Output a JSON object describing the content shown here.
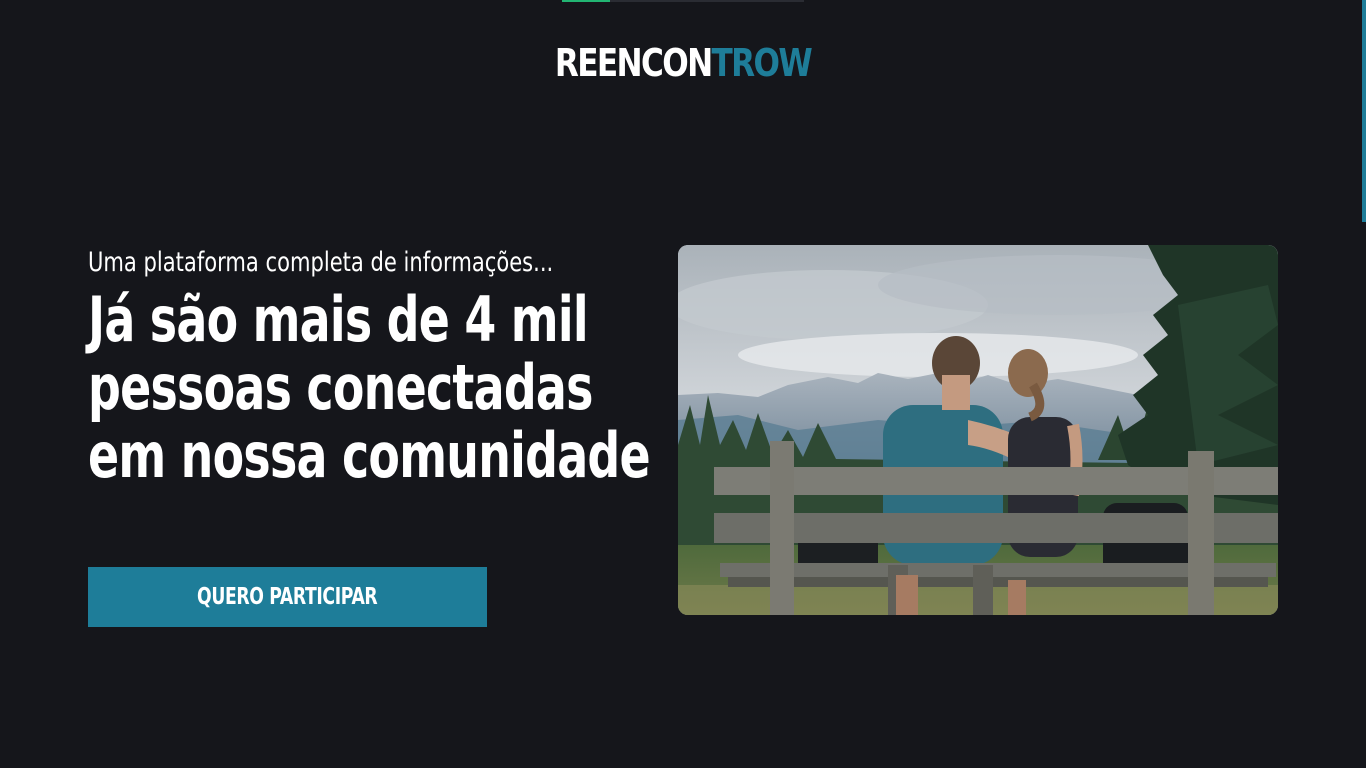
{
  "logo": {
    "part1": "REENCON",
    "part2": "TROW"
  },
  "hero": {
    "subtitle": "Uma plataforma completa de informações...",
    "headline_line1": "Já são mais de 4 mil",
    "headline_line2": "pessoas conectadas",
    "headline_line3": "em nossa comunidade",
    "cta_label": "QUERO PARTICIPAR",
    "image_alt": "Casal sentado em um banco de madeira olhando para as montanhas"
  },
  "colors": {
    "background": "#15161b",
    "accent": "#1e7d99",
    "progress": "#22b573"
  },
  "progress": {
    "fraction": 0.2
  }
}
